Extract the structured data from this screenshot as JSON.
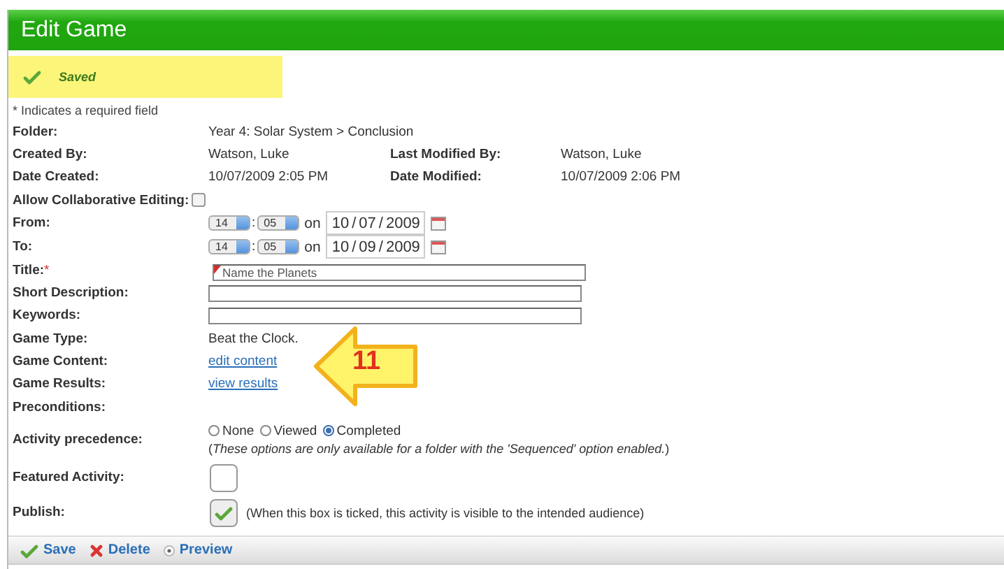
{
  "window": {
    "title": "Edit Game"
  },
  "notice": {
    "text": "Saved"
  },
  "required_note": "* Indicates a required field",
  "fields": [
    {
      "kind": "text",
      "label": "Folder:",
      "value": "Year 4: Solar System > Conclusion"
    },
    {
      "kind": "pair",
      "label": "Created By:",
      "value": "Watson, Luke",
      "label_2": "Last Modified By:",
      "value_2": "Watson, Luke"
    },
    {
      "kind": "pair",
      "label": "Date Created:",
      "value": "10/07/2009 2:05 PM",
      "label_2": "Date Modified:",
      "value_2": "10/07/2009 2:06 PM"
    },
    {
      "kind": "checkbox",
      "label": "Allow Collaborative Editing:",
      "checked": false
    },
    {
      "kind": "datetime",
      "label": "From:",
      "hour": "14",
      "time_separator": ":",
      "minute": "05",
      "on": "on",
      "day": "10",
      "separator": "/",
      "month": "07",
      "year": "2009"
    },
    {
      "kind": "datetime",
      "label": "To:",
      "hour": "14",
      "time_separator": ":",
      "minute": "05",
      "on": "on",
      "day": "10",
      "separator": "/",
      "month": "09",
      "year": "2009"
    },
    {
      "kind": "input",
      "label": "Title:",
      "required_mark": "*",
      "value": "Name the Planets"
    },
    {
      "kind": "input",
      "label": "Short Description:"
    },
    {
      "kind": "input",
      "label": "Keywords:"
    },
    {
      "kind": "text",
      "label": "Game Type:",
      "value": "Beat the Clock."
    },
    {
      "kind": "link",
      "label": "Game Content:",
      "value": "edit content"
    },
    {
      "kind": "link",
      "label": "Game Results:",
      "value": "view results"
    },
    {
      "kind": "text",
      "label": "Preconditions:"
    },
    {
      "kind": "radio",
      "label": "Activity precedence:",
      "options": [
        {
          "label": "None",
          "selected": false
        },
        {
          "label": "Viewed",
          "selected": false
        },
        {
          "label": "Completed",
          "selected": true
        }
      ],
      "note": "(*These options are only available for a folder with the 'Sequenced' option enabled.*)"
    },
    {
      "kind": "bigcheck",
      "label": "Featured Activity:",
      "checked": false
    },
    {
      "kind": "bigcheck",
      "label": "Publish:",
      "checked": true,
      "note": "(When this box is ticked, this activity is visible to the intended audience)"
    }
  ],
  "actions": [
    {
      "kind": "save",
      "label": "Save"
    },
    {
      "kind": "delete",
      "label": "Delete"
    },
    {
      "kind": "preview",
      "label": "Preview"
    }
  ],
  "callout": {
    "number": "11"
  }
}
